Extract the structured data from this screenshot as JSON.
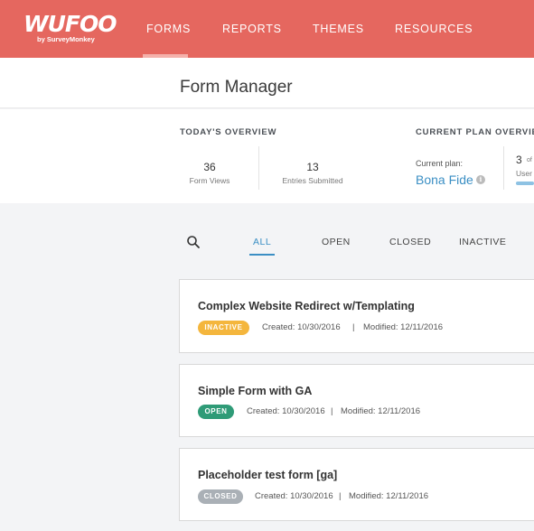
{
  "brand": {
    "logo_text": "WUFOO",
    "logo_sub": "by SurveyMonkey"
  },
  "nav": {
    "items": [
      {
        "label": "FORMS"
      },
      {
        "label": "REPORTS"
      },
      {
        "label": "THEMES"
      },
      {
        "label": "RESOURCES"
      }
    ],
    "active": "FORMS"
  },
  "page_title": "Form Manager",
  "overview": {
    "heading": "TODAY'S OVERVIEW",
    "stats": [
      {
        "value": "36",
        "label": "Form Views"
      },
      {
        "value": "13",
        "label": "Entries Submitted"
      }
    ]
  },
  "plan": {
    "heading": "CURRENT PLAN OVERVIE",
    "current_label": "Current plan:",
    "name": "Bona Fide",
    "info_icon": "info-icon",
    "users_value": "3",
    "users_of": "of",
    "users_label": "User",
    "users_progress_fraction": 1.0
  },
  "filters": {
    "tabs": [
      {
        "label": "ALL"
      },
      {
        "label": "OPEN"
      },
      {
        "label": "CLOSED"
      },
      {
        "label": "INACTIVE"
      }
    ],
    "active": "ALL"
  },
  "forms": [
    {
      "title": "Complex Website Redirect w/Templating",
      "status": "INACTIVE",
      "created": "Created: 10/30/2016",
      "separator": "|",
      "modified": "Modified: 12/11/2016"
    },
    {
      "title": "Simple Form with GA",
      "status": "OPEN",
      "created": "Created: 10/30/2016",
      "separator": "|",
      "modified": "Modified: 12/11/2016"
    },
    {
      "title": "Placeholder test form [ga]",
      "status": "CLOSED",
      "created": "Created: 10/30/2016",
      "separator": "|",
      "modified": "Modified: 12/11/2016"
    }
  ],
  "colors": {
    "brand": "#e5675f",
    "accent": "#3b8fc4",
    "status_inactive": "#f4b63d",
    "status_open": "#2f9b77",
    "status_closed": "#aab0b6"
  }
}
